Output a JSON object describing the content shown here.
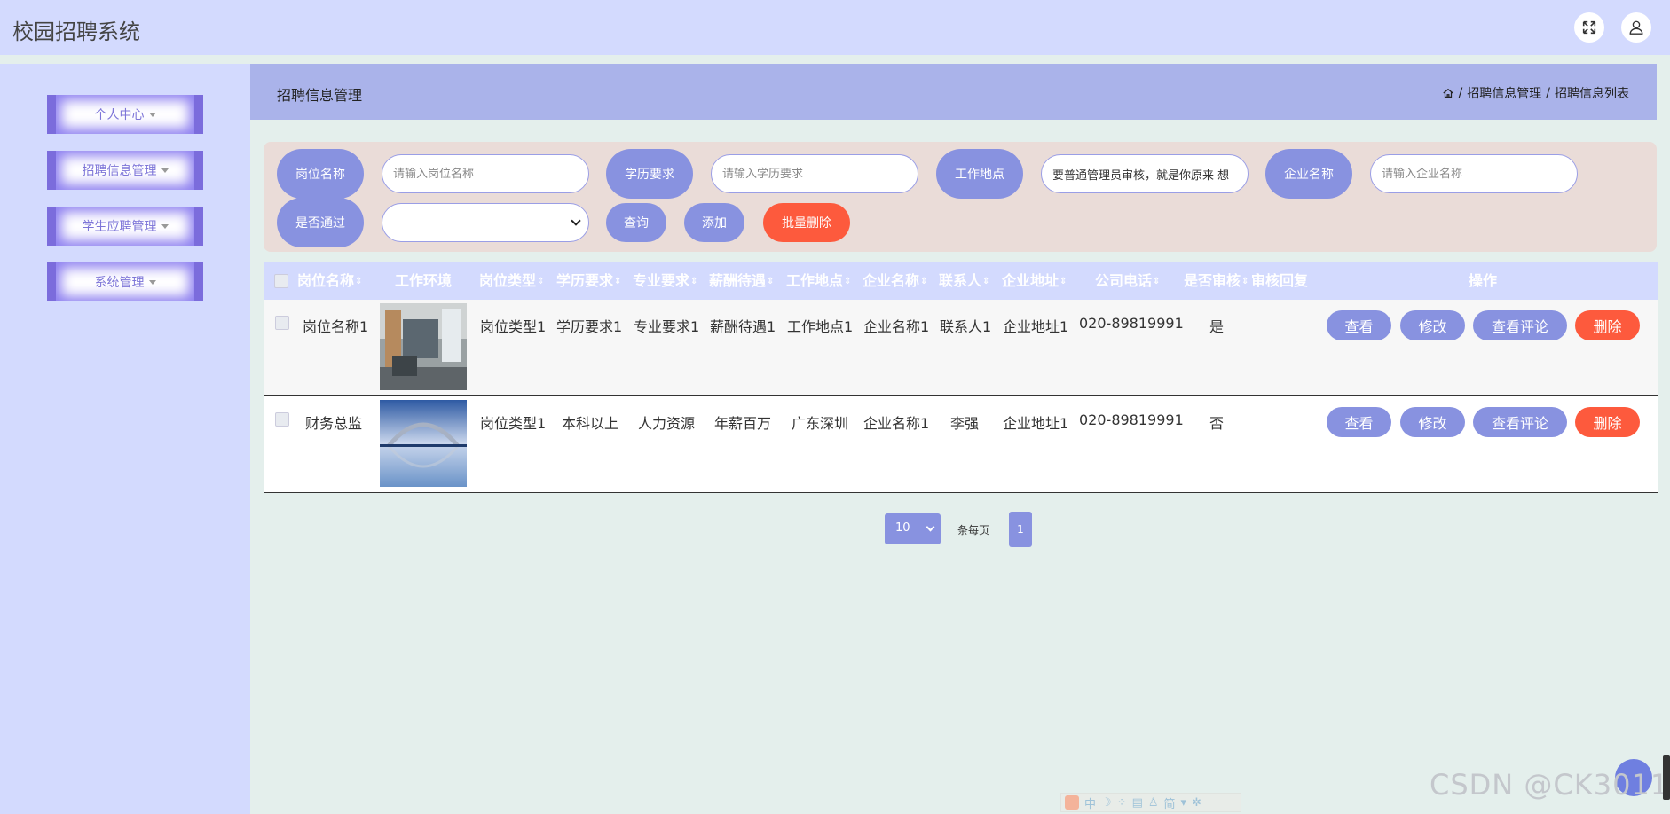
{
  "app": {
    "title": "校园招聘系统"
  },
  "header": {
    "fullscreen_icon": "fullscreen-icon",
    "user_icon": "user-icon"
  },
  "sidebar": {
    "items": [
      {
        "label": "个人中心"
      },
      {
        "label": "招聘信息管理"
      },
      {
        "label": "学生应聘管理"
      },
      {
        "label": "系统管理"
      }
    ]
  },
  "breadcrumb_bar": {
    "title": "招聘信息管理",
    "home_icon": "home-icon",
    "sep1": "/",
    "crumb1": "招聘信息管理",
    "sep2": "/",
    "crumb2": "招聘信息列表"
  },
  "search": {
    "label_position": "岗位名称",
    "placeholder_position": "请输入岗位名称",
    "label_education": "学历要求",
    "placeholder_education": "请输入学历要求",
    "label_location": "工作地点",
    "value_location": "要普通管理员审核，就是你原来 想",
    "label_company": "企业名称",
    "placeholder_company": "请输入企业名称",
    "label_passed": "是否通过",
    "passed_value": "",
    "query_button": "查询",
    "add_button": "添加",
    "batch_delete_button": "批量删除"
  },
  "table": {
    "columns": [
      "岗位名称",
      "工作环境",
      "岗位类型",
      "学历要求",
      "专业要求",
      "薪酬待遇",
      "工作地点",
      "企业名称",
      "联系人",
      "企业地址",
      "公司电话",
      "是否审核",
      "审核回复",
      "操作"
    ],
    "sort_glyph": "⇕",
    "rows": [
      {
        "name": "岗位名称1",
        "image": "office-interior-photo",
        "type": "岗位类型1",
        "education": "学历要求1",
        "major": "专业要求1",
        "salary": "薪酬待遇1",
        "location": "工作地点1",
        "company": "企业名称1",
        "contact": "联系人1",
        "address": "企业地址1",
        "phone": "020-89819991",
        "reviewed": "是",
        "reply": ""
      },
      {
        "name": "财务总监",
        "image": "bridge-landscape-photo",
        "type": "岗位类型1",
        "education": "本科以上",
        "major": "人力资源",
        "salary": "年薪百万",
        "location": "广东深圳",
        "company": "企业名称1",
        "contact": "李强",
        "address": "企业地址1",
        "phone": "020-89819991",
        "reviewed": "否",
        "reply": ""
      }
    ],
    "actions": {
      "view": "查看",
      "edit": "修改",
      "comments": "查看评论",
      "delete": "删除"
    }
  },
  "pagination": {
    "page_size": "10",
    "per_page_label": "条每页",
    "current_page": "1"
  },
  "watermark": "CSDN @CK3011",
  "ime_toolbar": {
    "mode": "中",
    "simplified": "简"
  },
  "colors": {
    "accent": "#8892e0",
    "danger": "#fd5a3d",
    "header_bg": "#d3dafe",
    "crumb_bg": "#aab3ea",
    "panel_bg": "#eadcd8",
    "page_bg": "#e4efec"
  }
}
